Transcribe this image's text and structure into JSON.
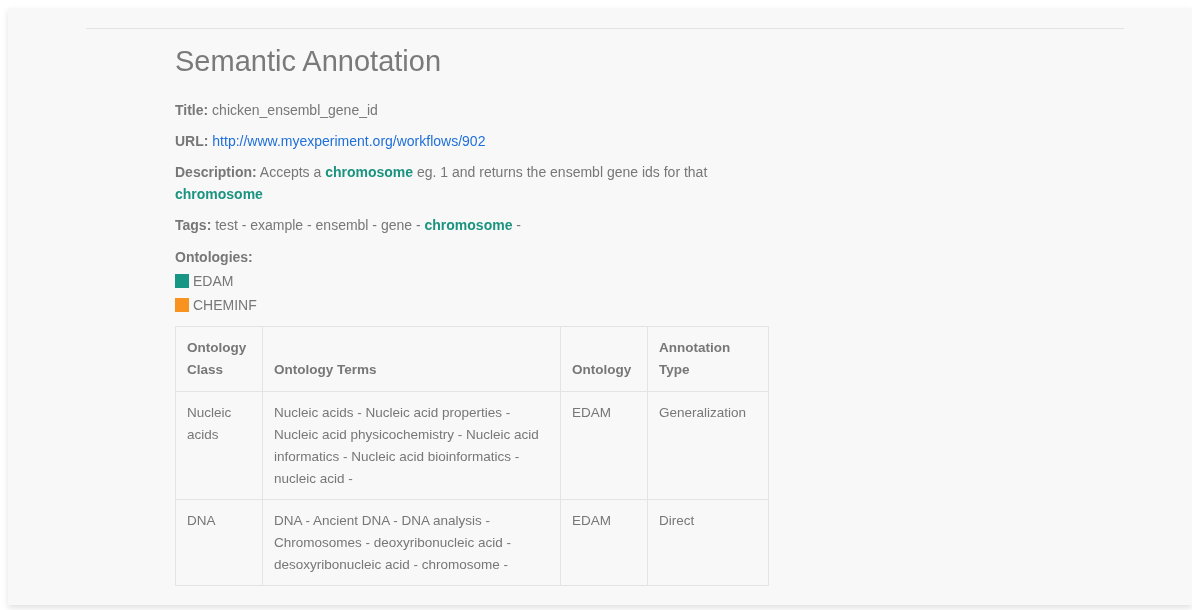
{
  "heading": "Semantic Annotation",
  "fields": [
    {
      "kind": "text",
      "label": "Title:",
      "value": "chicken_ensembl_gene_id"
    },
    {
      "kind": "link",
      "label": "URL:",
      "value": "http://www.myexperiment.org/workflows/902"
    },
    {
      "kind": "text",
      "label": "Description:",
      "value": "Accepts a **chromosome** eg. 1 and returns the ensembl gene ids for that **chromosome**"
    },
    {
      "kind": "text",
      "label": "Tags:",
      "value": "test - example - ensembl - gene - **chromosome** -"
    }
  ],
  "ontologies": {
    "label": "Ontologies:",
    "items": [
      {
        "name": "EDAM",
        "color": "#179683"
      },
      {
        "name": "CHEMINF",
        "color": "#f7931e"
      }
    ]
  },
  "table": {
    "columns": [
      "Ontology Class",
      "Ontology Terms",
      "Ontology",
      "Annotation Type"
    ],
    "rows": [
      [
        "Nucleic acids",
        "Nucleic acids - Nucleic acid properties - Nucleic acid physicochemistry - Nucleic acid informatics - Nucleic acid bioinformatics - nucleic acid -",
        "EDAM",
        "Generalization"
      ],
      [
        "DNA",
        "DNA - Ancient DNA - DNA analysis - Chromosomes - deoxyribonucleic acid - desoxyribonucleic acid - chromosome -",
        "EDAM",
        "Direct"
      ]
    ]
  }
}
